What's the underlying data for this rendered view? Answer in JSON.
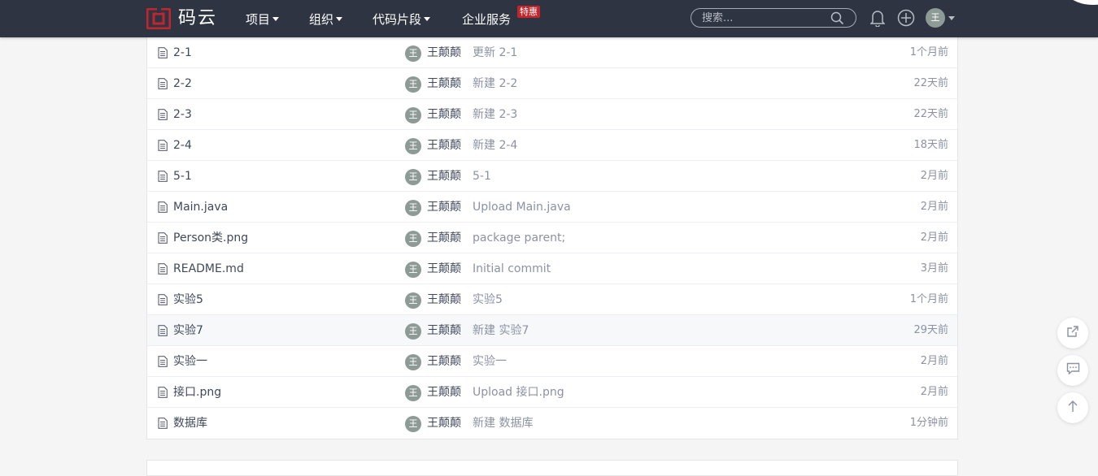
{
  "header": {
    "logo_text": "码云",
    "nav": [
      {
        "label": "项目"
      },
      {
        "label": "组织"
      },
      {
        "label": "代码片段"
      },
      {
        "label": "企业服务"
      }
    ],
    "hot_badge": "特惠",
    "search": {
      "placeholder": "搜索..."
    },
    "user_avatar": "王"
  },
  "files": [
    {
      "name": "2-1",
      "avatar": "王",
      "author": "王颠颠",
      "message": "更新 2-1",
      "time": "1个月前"
    },
    {
      "name": "2-2",
      "avatar": "王",
      "author": "王颠颠",
      "message": "新建 2-2",
      "time": "22天前"
    },
    {
      "name": "2-3",
      "avatar": "王",
      "author": "王颠颠",
      "message": "新建 2-3",
      "time": "22天前"
    },
    {
      "name": "2-4",
      "avatar": "王",
      "author": "王颠颠",
      "message": "新建 2-4",
      "time": "18天前"
    },
    {
      "name": "5-1",
      "avatar": "王",
      "author": "王颠颠",
      "message": "5-1",
      "time": "2月前"
    },
    {
      "name": "Main.java",
      "avatar": "王",
      "author": "王颠颠",
      "message": "Upload Main.java",
      "time": "2月前"
    },
    {
      "name": "Person类.png",
      "avatar": "王",
      "author": "王颠颠",
      "message": "package parent;",
      "time": "2月前"
    },
    {
      "name": "README.md",
      "avatar": "王",
      "author": "王颠颠",
      "message": "Initial commit",
      "time": "3月前"
    },
    {
      "name": "实验5",
      "avatar": "王",
      "author": "王颠颠",
      "message": "实验5",
      "time": "1个月前"
    },
    {
      "name": "实验7",
      "avatar": "王",
      "author": "王颠颠",
      "message": "新建 实验7",
      "time": "29天前"
    },
    {
      "name": "实验一",
      "avatar": "王",
      "author": "王颠颠",
      "message": "实验一",
      "time": "2月前"
    },
    {
      "name": "接口.png",
      "avatar": "王",
      "author": "王颠颠",
      "message": "Upload 接口.png",
      "time": "2月前"
    },
    {
      "name": "数据库",
      "avatar": "王",
      "author": "王颠颠",
      "message": "新建 数据库",
      "time": "1分钟前"
    }
  ],
  "icons": {
    "file": "file-text-icon",
    "bell": "bell-icon",
    "plus": "plus-circle-icon",
    "search": "search-icon",
    "share": "external-link-icon",
    "comment": "comment-icon",
    "top": "arrow-up-icon"
  },
  "colors": {
    "topbar": "#2f3442",
    "brand_red": "#c0262d",
    "text": "#40485b",
    "muted": "#8c92a4"
  }
}
